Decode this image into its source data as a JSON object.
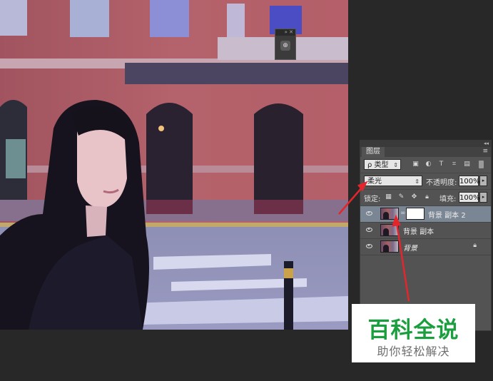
{
  "mini_panel": {
    "collapse": "»",
    "close": "✕",
    "button_icon": "layer-style-icon"
  },
  "layers_panel": {
    "collapse": "◂◂",
    "tab_label": "图层",
    "menu_icon": "≡",
    "filter": {
      "label": "ρ 类型",
      "icons": [
        "image-icon",
        "adjust-icon",
        "type-icon",
        "shape-icon",
        "smart-icon"
      ]
    },
    "blend_mode": "柔光",
    "opacity_label": "不透明度:",
    "opacity_value": "100%",
    "lock_label": "锁定:",
    "fill_label": "填充:",
    "fill_value": "100%",
    "layers": [
      {
        "name": "背景 副本 2",
        "selected": true,
        "has_mask": true
      },
      {
        "name": "背景 副本",
        "selected": false,
        "has_mask": false
      },
      {
        "name": "背景",
        "selected": false,
        "has_mask": false,
        "locked": true
      }
    ]
  },
  "watermark": {
    "title": "百科全说",
    "subtitle": "助你轻松解决"
  },
  "colors": {
    "arrow": "#e3262d",
    "watermark_green": "#1b9e3e",
    "selected_layer": "#7a8693"
  }
}
